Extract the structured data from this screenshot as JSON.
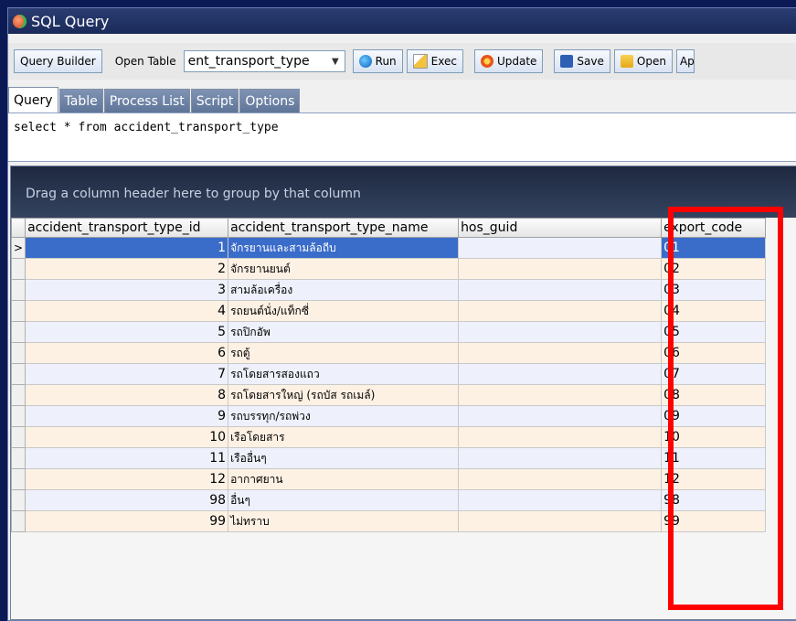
{
  "window": {
    "title": "SQL Query"
  },
  "toolbar": {
    "query_builder": "Query Builder",
    "open_table_label": "Open Table",
    "table_combo_value": "ent_transport_type",
    "run": "Run",
    "exec": "Exec",
    "update": "Update",
    "save": "Save",
    "open": "Open",
    "ap": "Ap"
  },
  "tabs": [
    "Query",
    "Table",
    "Process List",
    "Script",
    "Options"
  ],
  "editor": {
    "sql": "select * from accident_transport_type"
  },
  "grid": {
    "group_hint": "Drag a column header here to group by that column",
    "columns": [
      "accident_transport_type_id",
      "accident_transport_type_name",
      "hos_guid",
      "export_code"
    ],
    "rows": [
      {
        "id": "1",
        "name": "จักรยานและสามล้อถีบ",
        "guid": "",
        "export": "01"
      },
      {
        "id": "2",
        "name": "จักรยานยนต์",
        "guid": "",
        "export": "02"
      },
      {
        "id": "3",
        "name": "สามล้อเครื่อง",
        "guid": "",
        "export": "03"
      },
      {
        "id": "4",
        "name": "รถยนต์นั่ง/แท็กซี่",
        "guid": "",
        "export": "04"
      },
      {
        "id": "5",
        "name": "รถปิกอัพ",
        "guid": "",
        "export": "05"
      },
      {
        "id": "6",
        "name": "รถตู้",
        "guid": "",
        "export": "06"
      },
      {
        "id": "7",
        "name": "รถโดยสารสองแถว",
        "guid": "",
        "export": "07"
      },
      {
        "id": "8",
        "name": "รถโดยสารใหญ่ (รถบัส รถเมล์)",
        "guid": "",
        "export": "08"
      },
      {
        "id": "9",
        "name": "รถบรรทุก/รถพ่วง",
        "guid": "",
        "export": "09"
      },
      {
        "id": "10",
        "name": "เรือโดยสาร",
        "guid": "",
        "export": "10"
      },
      {
        "id": "11",
        "name": "เรืออื่นๆ",
        "guid": "",
        "export": "11"
      },
      {
        "id": "12",
        "name": "อากาศยาน",
        "guid": "",
        "export": "12"
      },
      {
        "id": "98",
        "name": "อื่นๆ",
        "guid": "",
        "export": "98"
      },
      {
        "id": "99",
        "name": "ไม่ทราบ",
        "guid": "",
        "export": "99"
      }
    ],
    "current_row_marker": ">"
  },
  "colors": {
    "highlight": "#ff0000",
    "selection": "#3a6cc9",
    "title_bar": "#1a2a5a"
  }
}
